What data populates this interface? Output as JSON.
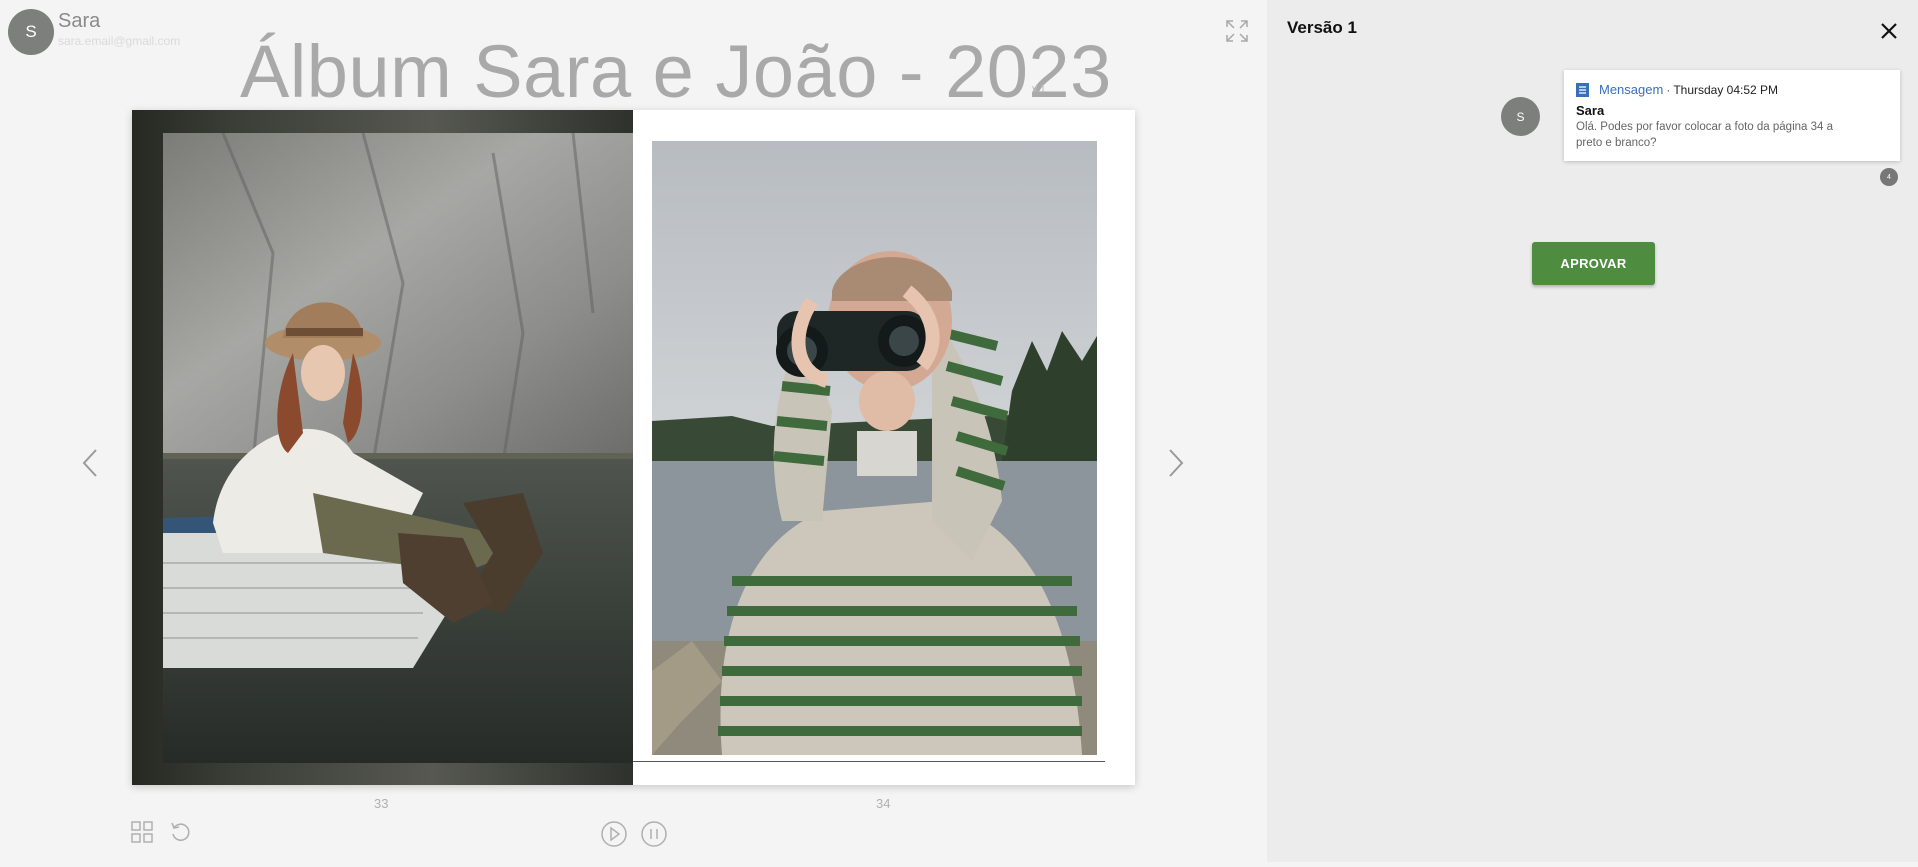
{
  "user": {
    "avatar_letter": "S",
    "name": "Sara",
    "email": "sara.email@gmail.com"
  },
  "album": {
    "title": "Álbum Sara e João - 2023",
    "version_tag": "v.1"
  },
  "pages": {
    "left_number": "33",
    "right_number": "34"
  },
  "panel": {
    "title": "Versão 1",
    "message": {
      "type": "Mensagem",
      "separator": "·",
      "time": "Thursday 04:52 PM",
      "author": "Sara",
      "text": "Olá. Podes por favor colocar a foto da página 34 a preto e branco?",
      "avatar_letter": "S",
      "reply_count": "4"
    },
    "approve_label": "APROVAR"
  },
  "icons": {
    "fullscreen": "expand-icon",
    "prev": "chevron-left-icon",
    "next": "chevron-right-icon",
    "grid": "grid-icon",
    "undo": "undo-icon",
    "play": "play-icon",
    "pause": "pause-icon",
    "close": "close-icon",
    "message_doc": "document-icon"
  },
  "colors": {
    "approve": "#4e8c3f",
    "link": "#3b6fb5",
    "avatar": "#7d7f7d"
  }
}
